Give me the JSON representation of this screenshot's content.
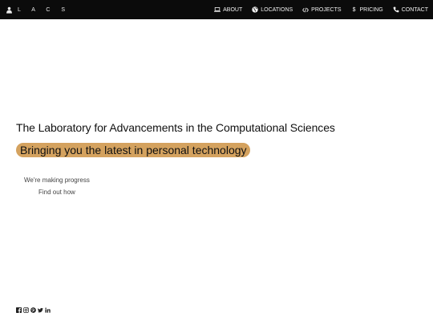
{
  "header": {
    "brand": "L A C S",
    "brand_icon": "person-icon",
    "nav": [
      {
        "label": "ABOUT",
        "icon": "laptop-icon"
      },
      {
        "label": "LOCATIONS",
        "icon": "globe-icon"
      },
      {
        "label": "PROJECTS",
        "icon": "code-icon"
      },
      {
        "label": "PRICING",
        "icon": "dollar-icon"
      },
      {
        "label": "CONTACT",
        "icon": "phone-icon"
      }
    ]
  },
  "hero": {
    "title": "The Laboratory for Advancements in the Computational Sciences",
    "tagline": "Bringing you the latest in personal technology"
  },
  "cta": {
    "text": "We're making progress",
    "link": "Find out how"
  },
  "social": {
    "icons": [
      "facebook-icon",
      "instagram-icon",
      "pinterest-icon",
      "twitter-icon",
      "linkedin-icon"
    ]
  },
  "colors": {
    "topbar": "#0b0b0b",
    "highlight": "#d4a25f"
  }
}
